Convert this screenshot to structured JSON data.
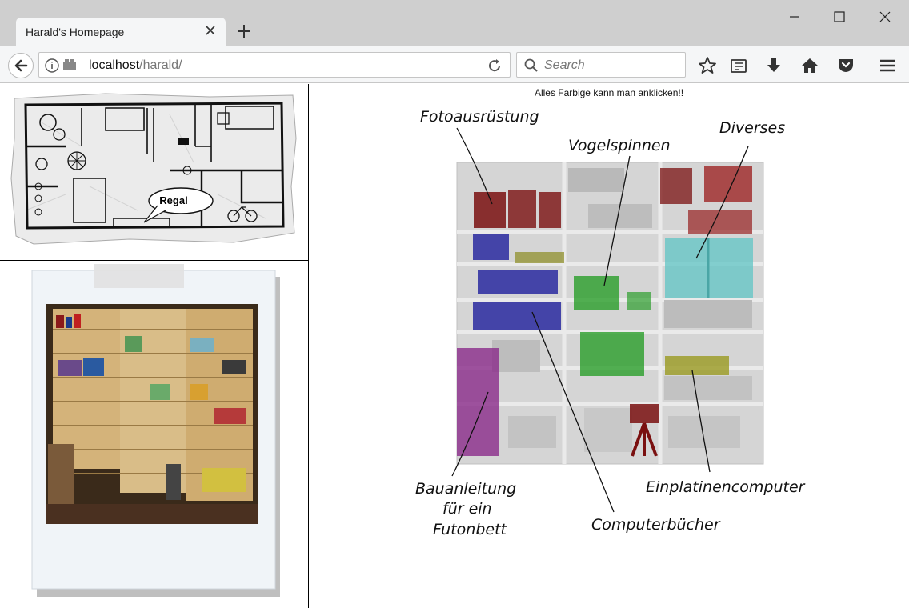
{
  "browser": {
    "tab_title": "Harald's Homepage",
    "url_host": "localhost",
    "url_path": "/harald/",
    "search_placeholder": "Search"
  },
  "page": {
    "instruction": "Alles Farbige kann man anklicken!!",
    "floorplan_bubble": "Regal",
    "annotations": {
      "foto": "Fotoausrüstung",
      "spinnen": "Vogelspinnen",
      "diverses": "Diverses",
      "bau1": "Bauanleitung",
      "bau2": "für ein",
      "bau3": "Futonbett",
      "computer": "Computerbücher",
      "einplatinen": "Einplatinencomputer"
    }
  },
  "colors": {
    "foto": "#7a1010",
    "computer": "#2a2aa0",
    "spinnen": "#1e9a1e",
    "diverses": "#5fc4c4",
    "einplatinen": "#9a9a20",
    "bau": "#8a2a8a"
  }
}
